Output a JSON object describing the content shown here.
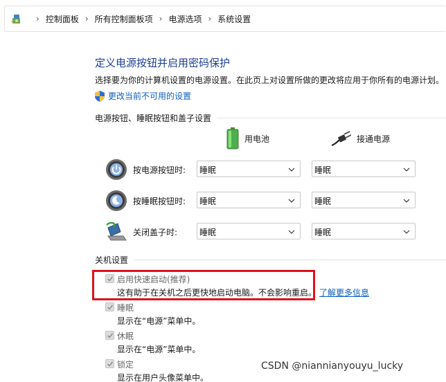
{
  "breadcrumb": {
    "items": [
      "控制面板",
      "所有控制面板项",
      "电源选项",
      "系统设置"
    ]
  },
  "page": {
    "title": "定义电源按钮并启用密码保护",
    "description": "选择要为你的计算机设置的电源设置。在此页上对设置所做的更改将应用于你所有的电源计划。",
    "change_link": "更改当前不可用的设置"
  },
  "power_section": {
    "header": "电源按钮、睡眠按钮和盖子设置",
    "col_battery": "用电池",
    "col_plugged": "接通电源",
    "rows": [
      {
        "label": "按电源按钮时:",
        "battery": "睡眠",
        "plugged": "睡眠"
      },
      {
        "label": "按睡眠按钮时:",
        "battery": "睡眠",
        "plugged": "睡眠"
      },
      {
        "label": "关闭盖子时:",
        "battery": "睡眠",
        "plugged": "睡眠"
      }
    ]
  },
  "shutdown_section": {
    "header": "关机设置",
    "options": [
      {
        "title": "启用快速启动(推荐)",
        "desc": "这有助于在关机之后更快地启动电脑。不会影响重启。",
        "link": "了解更多信息",
        "checked": true
      },
      {
        "title": "睡眠",
        "desc": "显示在“电源”菜单中。",
        "checked": true
      },
      {
        "title": "休眠",
        "desc": "显示在“电源”菜单中。",
        "checked": true
      },
      {
        "title": "锁定",
        "desc": "显示在用户头像菜单中。",
        "checked": true
      }
    ]
  },
  "watermark": "CSDN @niannianyouyu_lucky",
  "colors": {
    "title_blue": "#1c3f95",
    "link_blue": "#0a5fbf",
    "highlight_red": "#e0101c"
  }
}
